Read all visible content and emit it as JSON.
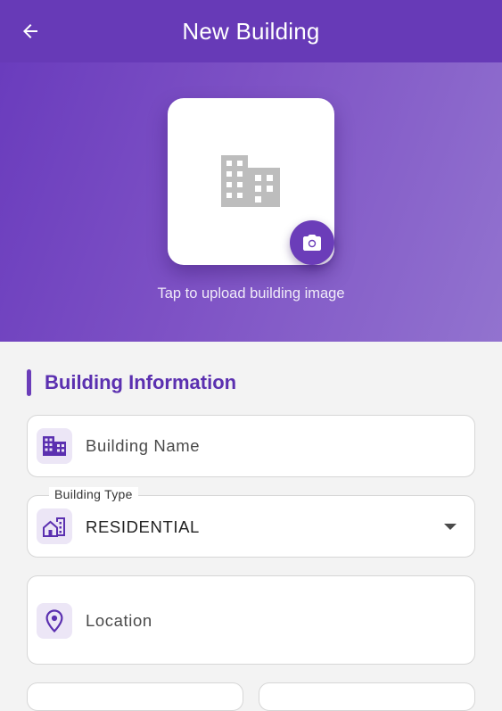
{
  "appbar": {
    "title": "New Building",
    "back_icon": "arrow-back-icon"
  },
  "image_upload": {
    "placeholder_icon": "building-icon",
    "camera_icon": "camera-icon",
    "hint": "Tap to upload building image"
  },
  "section": {
    "title": "Building Information"
  },
  "fields": {
    "building_name": {
      "placeholder": "Building Name",
      "icon": "building-icon"
    },
    "building_type": {
      "label": "Building Type",
      "value": "RESIDENTIAL",
      "icon": "house-buildings-icon"
    },
    "location": {
      "placeholder": "Location",
      "icon": "location-pin-icon"
    }
  },
  "colors": {
    "primary": "#673ab7",
    "hero_gradient_start": "#6a3cbd",
    "hero_gradient_end": "#9273cf",
    "accent_text": "#5b30b0",
    "icon_tint_bg": "#ece6f6",
    "page_background": "#f3f3f3"
  }
}
